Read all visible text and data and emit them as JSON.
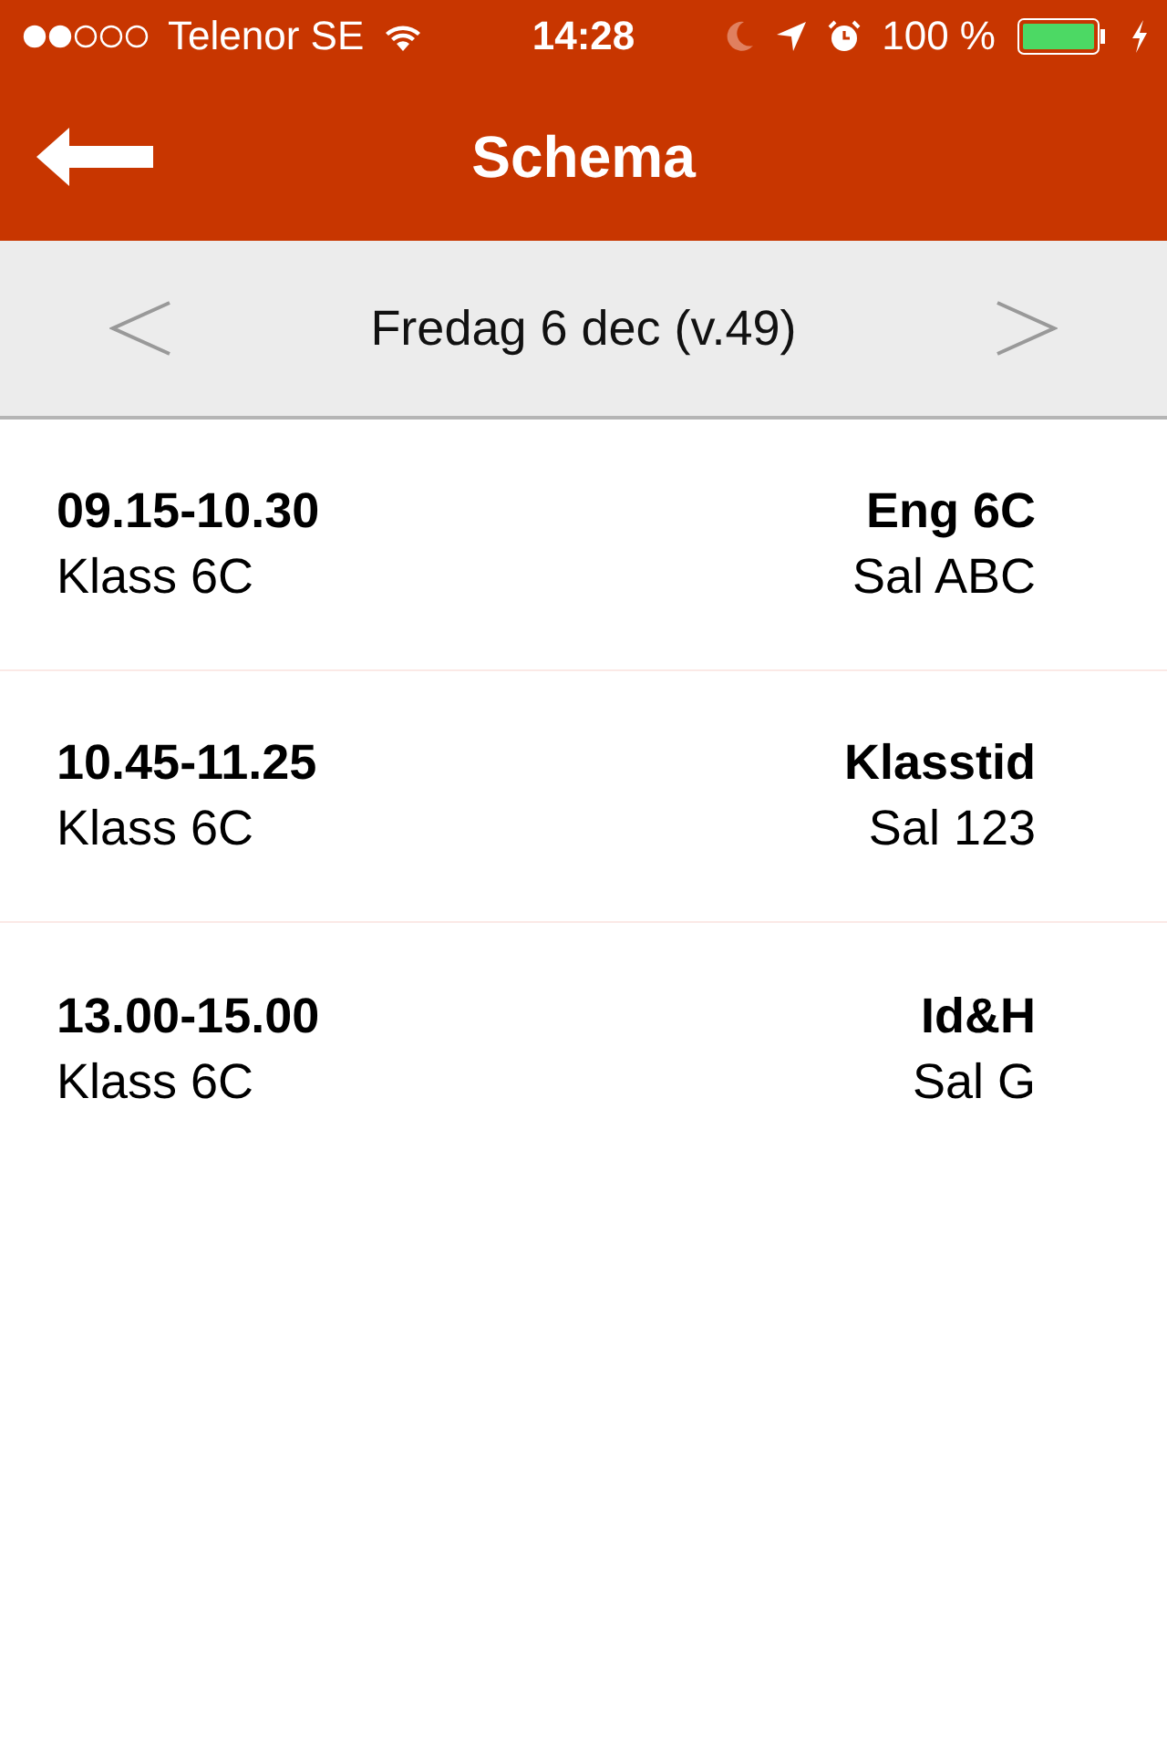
{
  "status_bar": {
    "carrier": "Telenor SE",
    "time": "14:28",
    "battery": "100 %"
  },
  "header": {
    "title": "Schema"
  },
  "date_bar": {
    "label": "Fredag 6 dec (v.49)"
  },
  "lessons": [
    {
      "time": "09.15-10.30",
      "group": "Klass 6C",
      "subject": "Eng 6C",
      "room": "Sal ABC"
    },
    {
      "time": "10.45-11.25",
      "group": "Klass 6C",
      "subject": "Klasstid",
      "room": "Sal 123"
    },
    {
      "time": "13.00-15.00",
      "group": "Klass 6C",
      "subject": "Id&H",
      "room": "Sal G"
    }
  ]
}
